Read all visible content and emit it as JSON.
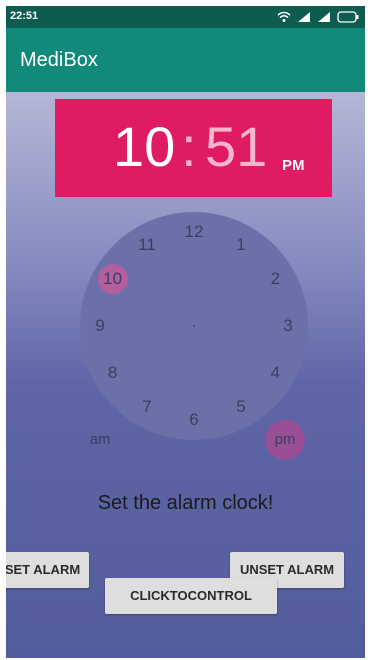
{
  "status_bar": {
    "time": "22:51",
    "icons": [
      "wifi-icon",
      "signal-icon",
      "signal-icon",
      "battery-icon"
    ]
  },
  "app": {
    "title": "MediBox"
  },
  "time_display": {
    "hour": "10",
    "separator": ":",
    "minute": "51",
    "ampm": "PM"
  },
  "clock": {
    "numbers": [
      "12",
      "1",
      "2",
      "3",
      "4",
      "5",
      "6",
      "7",
      "8",
      "9",
      "10",
      "11"
    ],
    "selected_hour": "10",
    "am_label": "am",
    "pm_label": "pm",
    "selected_period": "pm"
  },
  "prompt": "Set the alarm clock!",
  "buttons": {
    "set_alarm": "SET ALARM",
    "unset_alarm": "UNSET ALARM",
    "click_to_control": "CLICKTOCONTROL"
  },
  "colors": {
    "status_bar": "#0e5c4f",
    "app_bar": "#128a7a",
    "time_header": "#df1b62",
    "selection": "#b45e9c"
  }
}
